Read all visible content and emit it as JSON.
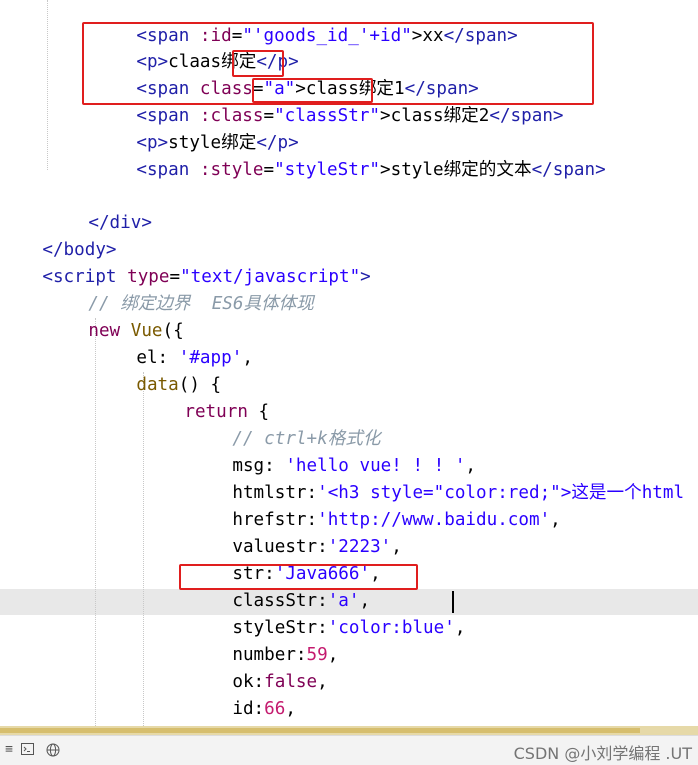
{
  "editor": {
    "lines": {
      "l1": [
        "<span",
        " :id",
        "=",
        "\"'goods_id_'+id\"",
        ">xx",
        "</span>"
      ],
      "l2": [
        "<p>",
        "claas绑定",
        "</p>"
      ],
      "l3": [
        "<span",
        " class",
        "=",
        "\"a\"",
        ">class绑定1",
        "</span>"
      ],
      "l4": [
        "<span",
        " :class",
        "=",
        "\"classStr\"",
        ">class绑定2",
        "</span>"
      ],
      "l5": [
        "<p>",
        "style绑定",
        "</p>"
      ],
      "l6": [
        "<span",
        " :style",
        "=",
        "\"styleStr\"",
        ">style绑定的文本",
        "</span>"
      ],
      "l8": "</div>",
      "l9": "</body>",
      "l10": [
        "<script",
        " type",
        "=",
        "\"text/javascript\"",
        ">"
      ],
      "l11": "// 绑定边界  ES6具体体现",
      "l12": [
        "new",
        " Vue",
        "({"
      ],
      "l13": [
        "el: ",
        "'#app'",
        ","
      ],
      "l14": [
        "data",
        "() {"
      ],
      "l15": [
        "return",
        " {"
      ],
      "l16": "// ctrl+k格式化",
      "l17": [
        "msg: ",
        "'hello vue! ! ! '",
        ","
      ],
      "l18": [
        "htmlstr:",
        "'<h3 style=\"color:red;\">这是一个html"
      ],
      "l19": [
        "hrefstr:",
        "'http://www.baidu.com'",
        ","
      ],
      "l20": [
        "valuestr:",
        "'2223'",
        ","
      ],
      "l21": [
        "str:",
        "'Java666'",
        ","
      ],
      "l22": [
        "classStr:",
        "'a'",
        ","
      ],
      "l23": [
        "styleStr:",
        "'color:blue'",
        ","
      ],
      "l24": [
        "number:",
        "59",
        ","
      ],
      "l25": [
        "ok:",
        "false",
        ","
      ],
      "l26": [
        "id:",
        "66",
        ","
      ]
    }
  },
  "statusbar": {
    "icons": [
      "menu-icon",
      "terminal-icon",
      "globe-icon"
    ],
    "watermark": "CSDN @小刘学编程 .UT"
  },
  "colors": {
    "highlight_box": "#e01e1e",
    "tag": "#1f1fa8",
    "attr": "#7f0055",
    "string": "#2a00ff",
    "number": "#c41a6e",
    "comment": "#8a9aa8"
  }
}
